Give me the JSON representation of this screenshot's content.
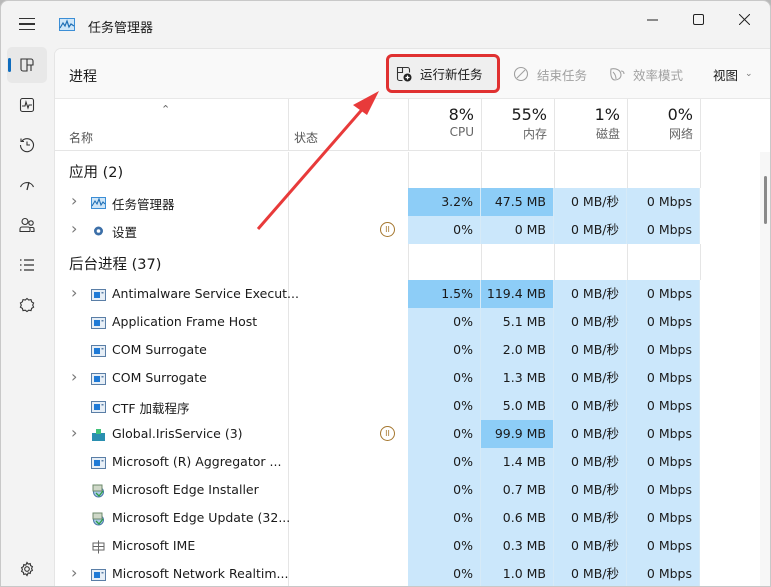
{
  "window": {
    "title": "任务管理器",
    "controls": [
      "minimize",
      "maximize",
      "close"
    ]
  },
  "sidebar": {
    "items": [
      {
        "id": "processes",
        "icon": "processes-icon",
        "active": true
      },
      {
        "id": "performance",
        "icon": "performance-icon",
        "active": false
      },
      {
        "id": "app-history",
        "icon": "history-icon",
        "active": false
      },
      {
        "id": "startup",
        "icon": "startup-icon",
        "active": false
      },
      {
        "id": "users",
        "icon": "users-icon",
        "active": false
      },
      {
        "id": "details",
        "icon": "details-icon",
        "active": false
      },
      {
        "id": "services",
        "icon": "services-icon",
        "active": false
      }
    ],
    "settings_icon": "settings-icon"
  },
  "toolbar": {
    "page_title": "进程",
    "run_new_task": "运行新任务",
    "end_task": "结束任务",
    "efficiency_mode": "效率模式",
    "view": "视图"
  },
  "header": {
    "name": "名称",
    "status": "状态",
    "cpu": {
      "pct": "8%",
      "label": "CPU"
    },
    "memory": {
      "pct": "55%",
      "label": "内存"
    },
    "disk": {
      "pct": "1%",
      "label": "磁盘"
    },
    "network": {
      "pct": "0%",
      "label": "网络"
    }
  },
  "groups": {
    "apps": {
      "label": "应用 (2)"
    },
    "background": {
      "label": "后台进程 (37)"
    }
  },
  "apps": [
    {
      "name": "任务管理器",
      "expandable": true,
      "icon": "task-manager",
      "status": "",
      "cpu": "3.2%",
      "memory": "47.5 MB",
      "disk": "0 MB/秒",
      "network": "0 Mbps",
      "cpu_hot": true,
      "mem_hot": true
    },
    {
      "name": "设置",
      "expandable": true,
      "icon": "gear",
      "status": "paused",
      "cpu": "0%",
      "memory": "0 MB",
      "disk": "0 MB/秒",
      "network": "0 Mbps",
      "cpu_hot": false,
      "mem_hot": false
    }
  ],
  "background": [
    {
      "name": "Antimalware Service Execut...",
      "expandable": true,
      "icon": "service",
      "status": "",
      "cpu": "1.5%",
      "memory": "119.4 MB",
      "disk": "0 MB/秒",
      "network": "0 Mbps",
      "cpu_hot": true,
      "mem_hot": true
    },
    {
      "name": "Application Frame Host",
      "expandable": false,
      "icon": "service",
      "status": "",
      "cpu": "0%",
      "memory": "5.1 MB",
      "disk": "0 MB/秒",
      "network": "0 Mbps",
      "cpu_hot": false,
      "mem_hot": false
    },
    {
      "name": "COM Surrogate",
      "expandable": false,
      "icon": "service",
      "status": "",
      "cpu": "0%",
      "memory": "2.0 MB",
      "disk": "0 MB/秒",
      "network": "0 Mbps",
      "cpu_hot": false,
      "mem_hot": false
    },
    {
      "name": "COM Surrogate",
      "expandable": true,
      "icon": "service",
      "status": "",
      "cpu": "0%",
      "memory": "1.3 MB",
      "disk": "0 MB/秒",
      "network": "0 Mbps",
      "cpu_hot": false,
      "mem_hot": false
    },
    {
      "name": "CTF 加载程序",
      "expandable": false,
      "icon": "service",
      "status": "",
      "cpu": "0%",
      "memory": "5.0 MB",
      "disk": "0 MB/秒",
      "network": "0 Mbps",
      "cpu_hot": false,
      "mem_hot": false
    },
    {
      "name": "Global.IrisService (3)",
      "expandable": true,
      "icon": "iris",
      "status": "paused",
      "cpu": "0%",
      "memory": "99.9 MB",
      "disk": "0 MB/秒",
      "network": "0 Mbps",
      "cpu_hot": false,
      "mem_hot": true
    },
    {
      "name": "Microsoft (R) Aggregator ...",
      "expandable": false,
      "icon": "service",
      "status": "",
      "cpu": "0%",
      "memory": "1.4 MB",
      "disk": "0 MB/秒",
      "network": "0 Mbps",
      "cpu_hot": false,
      "mem_hot": false
    },
    {
      "name": "Microsoft Edge Installer",
      "expandable": false,
      "icon": "installer",
      "status": "",
      "cpu": "0%",
      "memory": "0.7 MB",
      "disk": "0 MB/秒",
      "network": "0 Mbps",
      "cpu_hot": false,
      "mem_hot": false
    },
    {
      "name": "Microsoft Edge Update (32...",
      "expandable": false,
      "icon": "installer",
      "status": "",
      "cpu": "0%",
      "memory": "0.6 MB",
      "disk": "0 MB/秒",
      "network": "0 Mbps",
      "cpu_hot": false,
      "mem_hot": false
    },
    {
      "name": "Microsoft IME",
      "expandable": false,
      "icon": "ime",
      "status": "",
      "cpu": "0%",
      "memory": "0.3 MB",
      "disk": "0 MB/秒",
      "network": "0 Mbps",
      "cpu_hot": false,
      "mem_hot": false
    },
    {
      "name": "Microsoft Network Realtim...",
      "expandable": true,
      "icon": "service",
      "status": "",
      "cpu": "0%",
      "memory": "1.0 MB",
      "disk": "0 MB/秒",
      "network": "0 Mbps",
      "cpu_hot": false,
      "mem_hot": false
    }
  ],
  "colors": {
    "accent": "#0f6cbd",
    "heat_low": "#cbe7fb",
    "heat_high": "#8dcdf7",
    "annotation": "#e03131",
    "paused": "#a5772f"
  }
}
